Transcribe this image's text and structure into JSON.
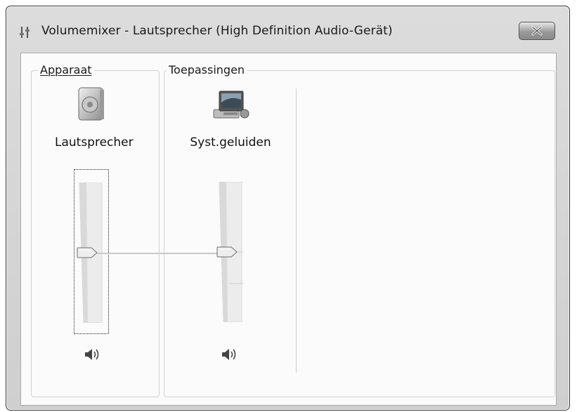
{
  "window": {
    "title": "Volumemixer - Lautsprecher (High Definition Audio-Gerät)"
  },
  "device_group": {
    "legend": "Apparaat",
    "device_name": "Lautsprecher",
    "volume_fraction": 0.5,
    "icon": "speaker-device-icon"
  },
  "applications_group": {
    "legend": "Toepassingen",
    "apps": [
      {
        "name": "Syst.geluiden",
        "volume_fraction": 0.5,
        "icon": "system-sounds-icon"
      }
    ]
  },
  "colors": {
    "window_frame": "#d4d4d4",
    "client_bg": "#fbfbfb",
    "group_border": "#d2d2d2"
  }
}
